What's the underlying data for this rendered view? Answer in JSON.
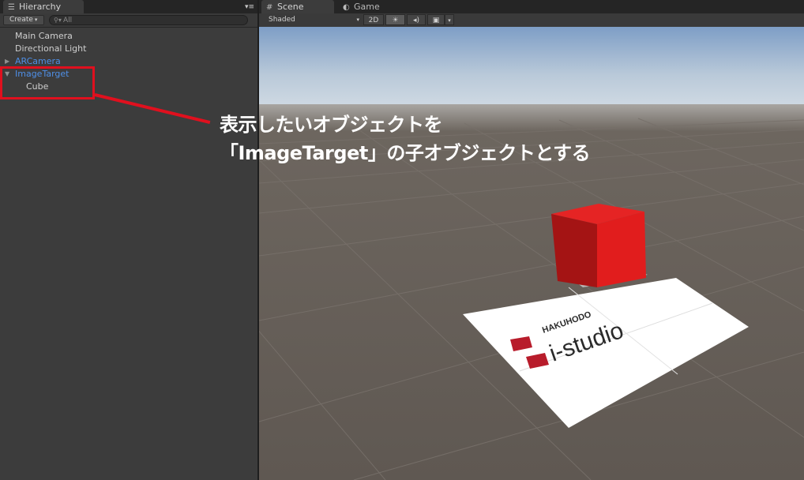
{
  "hierarchy": {
    "tab_label": "Hierarchy",
    "tab_icon": "list-icon",
    "menu_icon": "panel-menu-icon",
    "create_label": "Create",
    "search_placeholder": "All",
    "items": [
      {
        "label": "Main Camera",
        "color": "#cfcfcf",
        "expander": ""
      },
      {
        "label": "Directional Light",
        "color": "#cfcfcf",
        "expander": ""
      },
      {
        "label": "ARCamera",
        "color": "#4f8fe6",
        "expander": "collapsed"
      },
      {
        "label": "ImageTarget",
        "color": "#4f8fe6",
        "expander": "expanded"
      },
      {
        "label": "Cube",
        "color": "#cfcfcf",
        "expander": "",
        "indent": 1
      }
    ]
  },
  "scene": {
    "tabs": [
      {
        "label": "Scene",
        "icon": "grid-icon",
        "active": true
      },
      {
        "label": "Game",
        "icon": "pacman-icon",
        "active": false
      }
    ],
    "shading_mode": "Shaded",
    "btn_2d": "2D",
    "target_image": {
      "brand_top": "HAKUHODO",
      "brand_main": "i-studio"
    }
  },
  "annotation": {
    "line1": "表示したいオブジェクトを",
    "line2": "「ImageTarget」の子オブジェクトとする",
    "color": "#e0101e"
  },
  "colors": {
    "sky_top": "#7e9ec6",
    "sky_bottom": "#ced9e3",
    "ground": "#645d56",
    "cube_red": "#e21c1c",
    "highlight": "#e0101e"
  }
}
